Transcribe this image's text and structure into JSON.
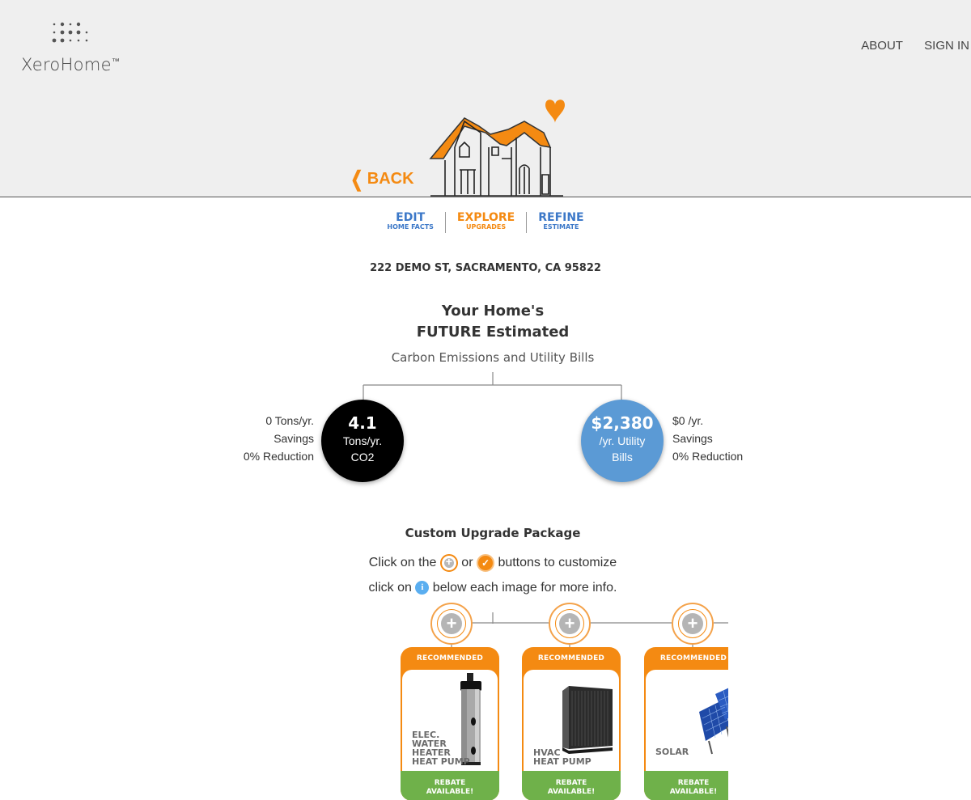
{
  "header": {
    "logo_text": "XeroHome",
    "logo_mark": "™",
    "nav": {
      "about": "ABOUT",
      "signin": "SIGN IN"
    },
    "back_label": "BACK"
  },
  "steps": [
    {
      "big": "EDIT",
      "small": "HOME FACTS",
      "color": "#3c78c8"
    },
    {
      "big": "EXPLORE",
      "small": "UPGRADES",
      "color": "#f48a12"
    },
    {
      "big": "REFINE",
      "small": "ESTIMATE",
      "color": "#3c78c8"
    }
  ],
  "address": "222 DEMO ST, SACRAMENTO, CA 95822",
  "headline": {
    "line1": "Your Home's",
    "line2": "FUTURE Estimated",
    "subtitle": "Carbon Emissions and Utility Bills"
  },
  "emissions": {
    "value": "4.1",
    "unit": "Tons/yr.",
    "label": "CO2",
    "side": [
      "0 Tons/yr.",
      "Savings",
      "0% Reduction"
    ]
  },
  "bills": {
    "value": "$2,380",
    "unit": "/yr. Utility",
    "label": "Bills",
    "side": [
      "$0 /yr.",
      "Savings",
      "0% Reduction"
    ]
  },
  "package": {
    "title": "Custom Upgrade Package",
    "instr1_a": "Click on the",
    "instr1_b": "or",
    "instr1_c": "buttons to customize",
    "instr2_a": "click on",
    "instr2_b": "below each image for more info."
  },
  "cards": [
    {
      "badge": "RECOMMENDED",
      "label": [
        "ELEC.",
        "WATER",
        "HEATER",
        "HEAT PUMP"
      ],
      "rebate": [
        "REBATE",
        "AVAILABLE!"
      ]
    },
    {
      "badge": "RECOMMENDED",
      "label": [
        "HVAC",
        "HEAT PUMP"
      ],
      "rebate": [
        "REBATE",
        "AVAILABLE!"
      ]
    },
    {
      "badge": "RECOMMENDED",
      "label": [
        "SOLAR"
      ],
      "rebate": [
        "REBATE",
        "AVAILABLE!"
      ]
    }
  ],
  "colors": {
    "accent": "#f48a12",
    "blue": "#3c78c8",
    "circle_blue": "#5b9ad5",
    "rebate_green": "#6fb14a"
  }
}
